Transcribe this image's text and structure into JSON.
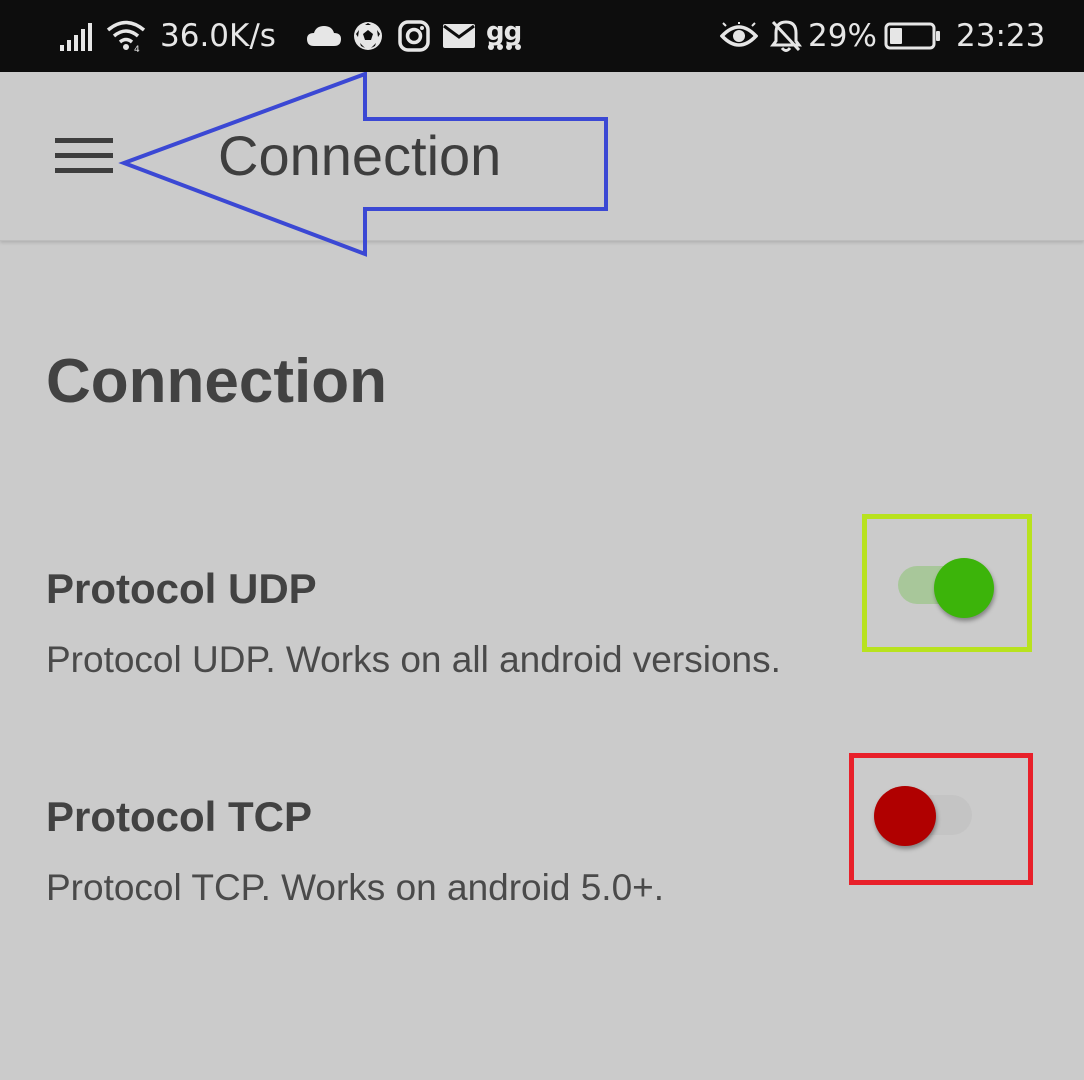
{
  "status_bar": {
    "network_speed": "36.0K/s",
    "gg_label": "gg",
    "battery": "29%",
    "time": "23:23",
    "icons": [
      "signal-icon",
      "wifi-icon",
      "cloud-icon",
      "soccer-ball-icon",
      "instagram-icon",
      "mail-icon",
      "gg-icon",
      "eye-icon",
      "bell-off-icon",
      "battery-icon"
    ]
  },
  "app_bar": {
    "title": "Connection",
    "menu_icon": "hamburger-menu-icon"
  },
  "section": {
    "title": "Connection"
  },
  "preferences": [
    {
      "title": "Protocol UDP",
      "summary": "Protocol UDP. Works on all android versions.",
      "enabled": true,
      "thumb_color": "#3cb40a",
      "highlight_color": "#b8e21e"
    },
    {
      "title": "Protocol TCP",
      "summary": "Protocol TCP. Works on android 5.0+.",
      "enabled": false,
      "thumb_color": "#b00000",
      "highlight_color": "#e8202a"
    }
  ],
  "colors": {
    "background": "#cbcbcb",
    "status_bar": "#0d0d0d",
    "annotation_arrow": "#3b48d4"
  }
}
